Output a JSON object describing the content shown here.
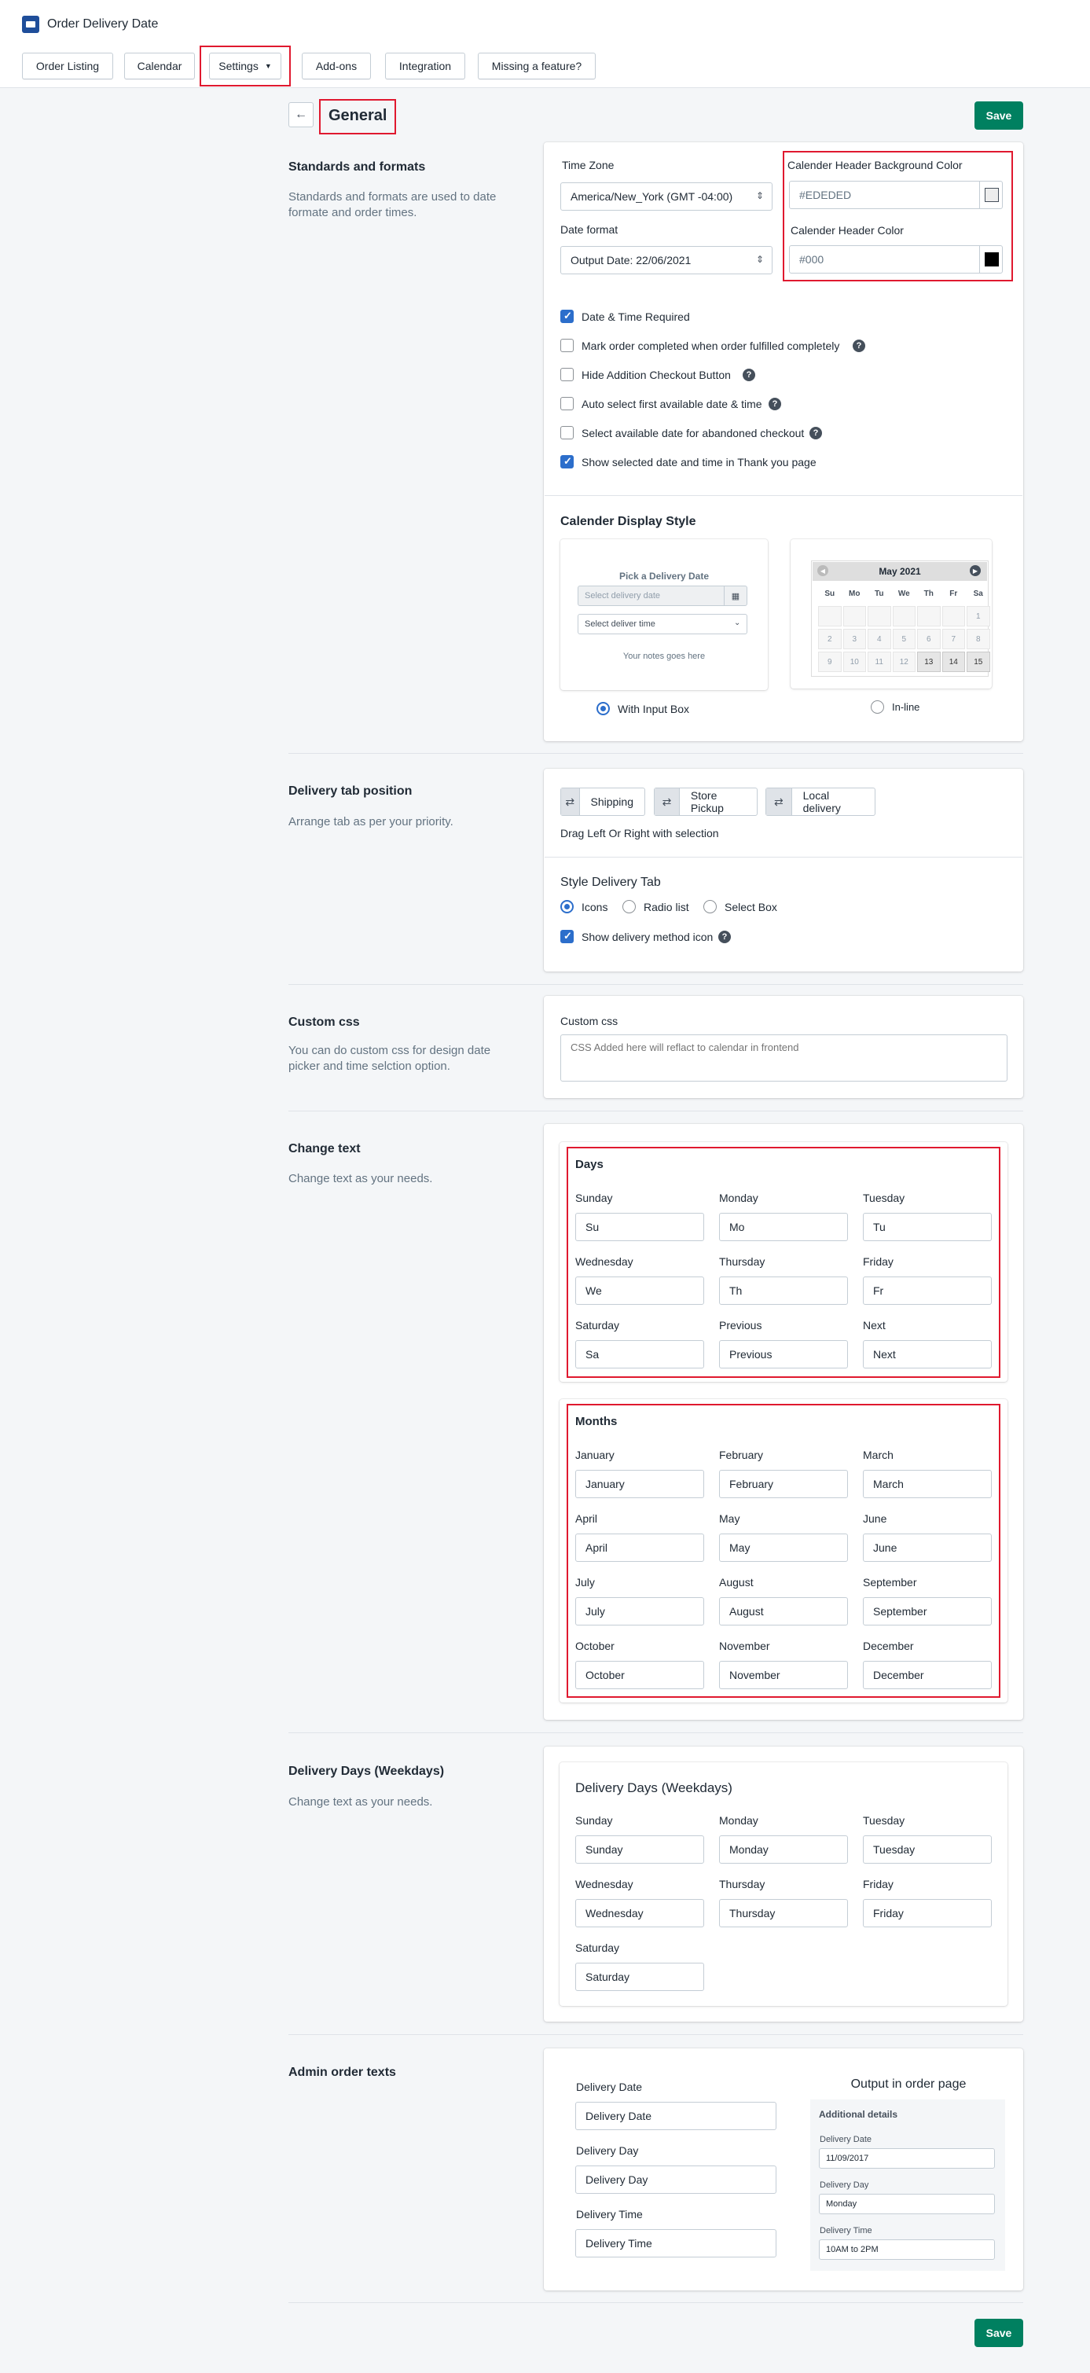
{
  "app": {
    "title": "Order Delivery Date"
  },
  "nav": [
    "Order Listing",
    "Calendar",
    "Settings",
    "Add-ons",
    "Integration",
    "Missing a feature?"
  ],
  "page": {
    "title": "General",
    "save": "Save",
    "save_bottom": "Save"
  },
  "standards": {
    "heading": "Standards and formats",
    "desc": "Standards and formats are used to date formate and order times.",
    "timezone_label": "Time Zone",
    "timezone_value": "America/New_York  (GMT -04:00)",
    "dateformat_label": "Date format",
    "dateformat_value": "Output Date: 22/06/2021",
    "hdr_bg_label": "Calender Header Background Color",
    "hdr_bg_value": "#EDEDED",
    "hdr_bg_swatch": "#EDEDED",
    "hdr_color_label": "Calender Header Color",
    "hdr_color_value": "#000",
    "hdr_color_swatch": "#000000",
    "checks": [
      {
        "label": "Date & Time Required",
        "checked": true,
        "help": false
      },
      {
        "label": "Mark order completed when order fulfilled completely",
        "checked": false,
        "help": true
      },
      {
        "label": "Hide Addition Checkout Button",
        "checked": false,
        "help": true
      },
      {
        "label": "Auto select first available date & time",
        "checked": false,
        "help": true
      },
      {
        "label": "Select available date for abandoned checkout",
        "checked": false,
        "help": true
      },
      {
        "label": "Show selected date and time in Thank you page",
        "checked": true,
        "help": false
      }
    ],
    "display_style_title": "Calender Display Style",
    "preview": {
      "pick_title": "Pick a Delivery Date",
      "date_placeholder": "Select delivery date",
      "time_placeholder": "Select deliver time",
      "notes": "Your notes goes here",
      "month": "May 2021",
      "weekdays": [
        "Su",
        "Mo",
        "Tu",
        "We",
        "Th",
        "Fr",
        "Sa"
      ],
      "rows": [
        [
          "",
          "",
          "",
          "",
          "",
          "",
          "1"
        ],
        [
          "2",
          "3",
          "4",
          "5",
          "6",
          "7",
          "8"
        ],
        [
          "9",
          "10",
          "11",
          "12",
          "13",
          "14",
          "15"
        ]
      ]
    },
    "option_input": "With Input Box",
    "option_inline": "In-line"
  },
  "delivery_tab": {
    "heading": "Delivery tab position",
    "desc": "Arrange tab as per your priority.",
    "tabs": [
      "Shipping",
      "Store Pickup",
      "Local delivery"
    ],
    "hint": "Drag Left Or Right with selection",
    "style_title": "Style Delivery Tab",
    "style_options": [
      "Icons",
      "Radio list",
      "Select Box"
    ],
    "show_icon": "Show delivery method icon"
  },
  "custom_css": {
    "heading": "Custom css",
    "desc": "You can do custom css for design date picker and time selction option.",
    "label": "Custom css",
    "placeholder": "CSS Added here will reflact to calendar in frontend"
  },
  "change_text": {
    "heading": "Change text",
    "desc": "Change text as your needs.",
    "days_title": "Days",
    "days": [
      {
        "label": "Sunday",
        "value": "Su"
      },
      {
        "label": "Monday",
        "value": "Mo"
      },
      {
        "label": "Tuesday",
        "value": "Tu"
      },
      {
        "label": "Wednesday",
        "value": "We"
      },
      {
        "label": "Thursday",
        "value": "Th"
      },
      {
        "label": "Friday",
        "value": "Fr"
      },
      {
        "label": "Saturday",
        "value": "Sa"
      },
      {
        "label": "Previous",
        "value": "Previous"
      },
      {
        "label": "Next",
        "value": "Next"
      }
    ],
    "months_title": "Months",
    "months": [
      {
        "label": "January",
        "value": "January"
      },
      {
        "label": "February",
        "value": "February"
      },
      {
        "label": "March",
        "value": "March"
      },
      {
        "label": "April",
        "value": "April"
      },
      {
        "label": "May",
        "value": "May"
      },
      {
        "label": "June",
        "value": "June"
      },
      {
        "label": "July",
        "value": "July"
      },
      {
        "label": "August",
        "value": "August"
      },
      {
        "label": "September",
        "value": "September"
      },
      {
        "label": "October",
        "value": "October"
      },
      {
        "label": "November",
        "value": "November"
      },
      {
        "label": "December",
        "value": "December"
      }
    ]
  },
  "weekdays": {
    "heading": "Delivery Days (Weekdays)",
    "desc": "Change text as your needs.",
    "title": "Delivery Days (Weekdays)",
    "fields": [
      {
        "label": "Sunday",
        "value": "Sunday"
      },
      {
        "label": "Monday",
        "value": "Monday"
      },
      {
        "label": "Tuesday",
        "value": "Tuesday"
      },
      {
        "label": "Wednesday",
        "value": "Wednesday"
      },
      {
        "label": "Thursday",
        "value": "Thursday"
      },
      {
        "label": "Friday",
        "value": "Friday"
      },
      {
        "label": "Saturday",
        "value": "Saturday"
      }
    ]
  },
  "admin": {
    "heading": "Admin order texts",
    "fields": [
      {
        "label": "Delivery Date",
        "value": "Delivery Date"
      },
      {
        "label": "Delivery Day",
        "value": "Delivery Day"
      },
      {
        "label": "Delivery Time",
        "value": "Delivery Time"
      }
    ],
    "output_title": "Output in order page",
    "additional": "Additional details",
    "out_fields": [
      {
        "label": "Delivery Date",
        "value": "11/09/2017"
      },
      {
        "label": "Delivery Day",
        "value": "Monday"
      },
      {
        "label": "Delivery Time",
        "value": "10AM to 2PM"
      }
    ]
  }
}
